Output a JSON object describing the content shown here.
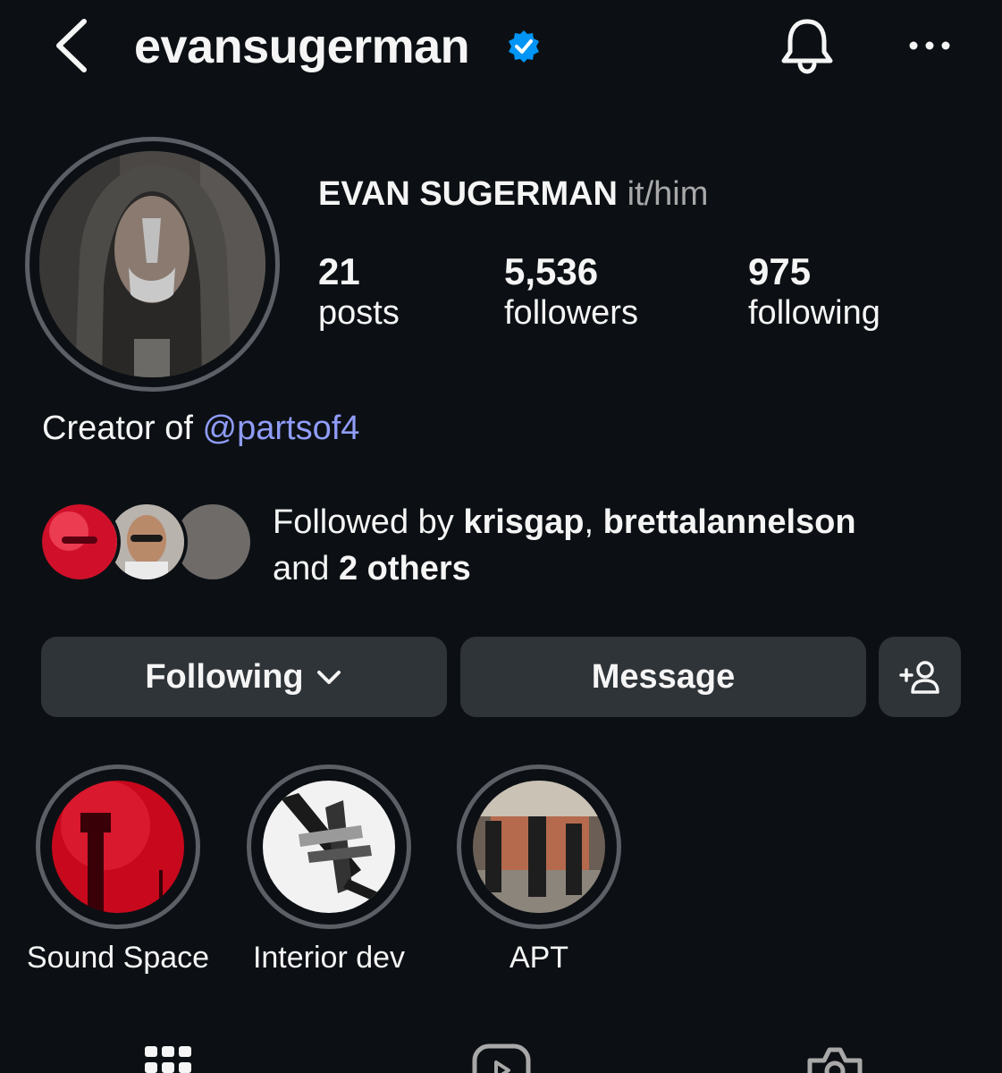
{
  "header": {
    "username": "evansugerman",
    "back_icon": "chevron-left-icon",
    "verified_icon": "verified-badge-icon",
    "notifications_icon": "bell-icon",
    "more_icon": "more-horizontal-icon"
  },
  "profile": {
    "display_name": "EVAN SUGERMAN",
    "pronouns": "it/him",
    "stats": {
      "posts": {
        "value": "21",
        "label": "posts"
      },
      "followers": {
        "value": "5,536",
        "label": "followers"
      },
      "following": {
        "value": "975",
        "label": "following"
      }
    },
    "bio_prefix": "Creator of",
    "bio_mention": "@partsof4"
  },
  "followed_by": {
    "prefix": "Followed by",
    "user1": "krisgap",
    "separator": ",",
    "user2": "brettalannelson",
    "and": "and",
    "others": "2 others"
  },
  "actions": {
    "following_label": "Following",
    "message_label": "Message",
    "add_user_icon": "add-person-icon"
  },
  "highlights": [
    {
      "label": "Sound Space"
    },
    {
      "label": "Interior dev"
    },
    {
      "label": "APT"
    }
  ],
  "tabs": [
    {
      "icon": "grid-icon"
    },
    {
      "icon": "reels-icon"
    },
    {
      "icon": "tagged-icon"
    }
  ],
  "colors": {
    "background": "#0c1014",
    "button": "#2f3439",
    "mention": "#8f9cf7",
    "verified": "#0095f6",
    "muted": "#a8a8a8"
  }
}
